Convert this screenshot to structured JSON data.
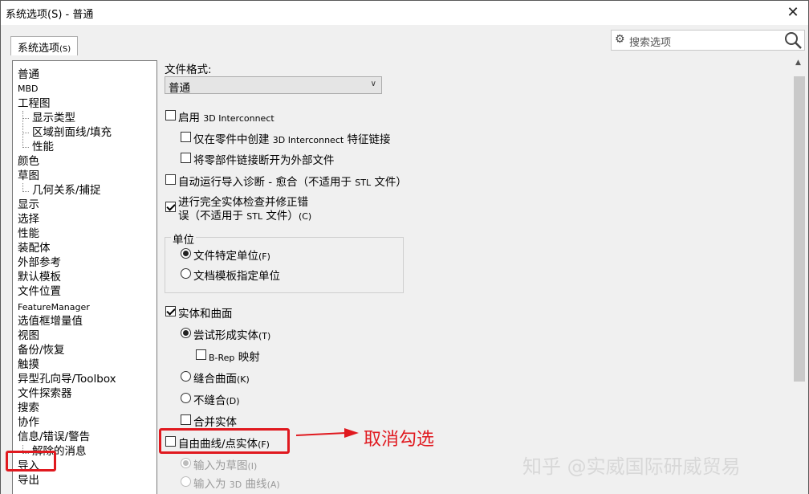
{
  "window": {
    "title": "系统选项(S) - 普通",
    "close_glyph": "✕"
  },
  "tab": {
    "label": "系统选项",
    "suffix": "(S)"
  },
  "search": {
    "placeholder": "搜索选项",
    "gear_glyph": "⚙"
  },
  "nav": {
    "items": [
      {
        "label": "普通"
      },
      {
        "label": "MBD"
      },
      {
        "label": "工程图"
      },
      {
        "label": "显示类型"
      },
      {
        "label": "区域剖面线/填充"
      },
      {
        "label": "性能"
      },
      {
        "label": "颜色"
      },
      {
        "label": "草图"
      },
      {
        "label": "几何关系/捕捉"
      },
      {
        "label": "显示"
      },
      {
        "label": "选择"
      },
      {
        "label": "性能"
      },
      {
        "label": "装配体"
      },
      {
        "label": "外部参考"
      },
      {
        "label": "默认模板"
      },
      {
        "label": "文件位置"
      },
      {
        "label": "FeatureManager"
      },
      {
        "label": "选值框增量值"
      },
      {
        "label": "视图"
      },
      {
        "label": "备份/恢复"
      },
      {
        "label": "触摸"
      },
      {
        "label": "异型孔向导/Toolbox"
      },
      {
        "label": "文件探索器"
      },
      {
        "label": "搜索"
      },
      {
        "label": "协作"
      },
      {
        "label": "信息/错误/警告"
      },
      {
        "label": "解除的消息"
      },
      {
        "label": "导入"
      },
      {
        "label": "导出"
      }
    ]
  },
  "content": {
    "file_format_label": "文件格式:",
    "file_format_value": "普通",
    "opt_3d_interconnect": {
      "pre": "启用 ",
      "small": "3D Interconnect",
      "post": ""
    },
    "opt_link_only": {
      "pre": "仅在零件中创建 ",
      "small": "3D Interconnect",
      "post": " 特征链接"
    },
    "opt_break_links": "将零部件链接断开为外部文件",
    "opt_auto_diag": {
      "pre": "自动运行导入诊断 - 愈合（不适用于 ",
      "small": "STL",
      "post": " 文件）"
    },
    "opt_full_check_line1": "进行完全实体检查并修正错",
    "opt_full_check_line2": {
      "pre": "误（不适用于 ",
      "small": "STL",
      "post": " 文件）",
      "hotkey": "(C)"
    },
    "units_group_label": "单位",
    "unit_file_specific": {
      "text": "文件特定单位",
      "hotkey": "(F)"
    },
    "unit_doc_template": "文档模板指定单位",
    "opt_solid_surface": "实体和曲面",
    "opt_try_solid": {
      "text": "尝试形成实体",
      "hotkey": "(T)"
    },
    "opt_brep": {
      "small": "B-Rep",
      "post": " 映射"
    },
    "opt_knit": {
      "text": "缝合曲面",
      "hotkey": "(K)"
    },
    "opt_no_knit": {
      "text": "不缝合",
      "hotkey": "(D)"
    },
    "opt_merge": "合并实体",
    "opt_free_curves": {
      "text": "自由曲线/点实体",
      "hotkey": "(F)"
    },
    "opt_import_sketch": {
      "text": "输入为草图",
      "hotkey": "(I)"
    },
    "opt_import_3d": {
      "pre": "输入为 ",
      "small": "3D",
      "post": " 曲线",
      "hotkey": "(A)"
    }
  },
  "state": {
    "opt_3d_interconnect": false,
    "opt_link_only": false,
    "opt_break_links": false,
    "opt_auto_diag": false,
    "opt_full_check": true,
    "units": "file_specific",
    "opt_solid_surface": true,
    "solid_mode": "try_solid",
    "opt_brep": false,
    "opt_merge": false,
    "opt_free_curves": false,
    "free_curves_mode": "sketch"
  },
  "annotation": {
    "text": "取消勾选",
    "color": "#e0191f"
  },
  "watermark": "知乎 @实威国际研威贸易"
}
